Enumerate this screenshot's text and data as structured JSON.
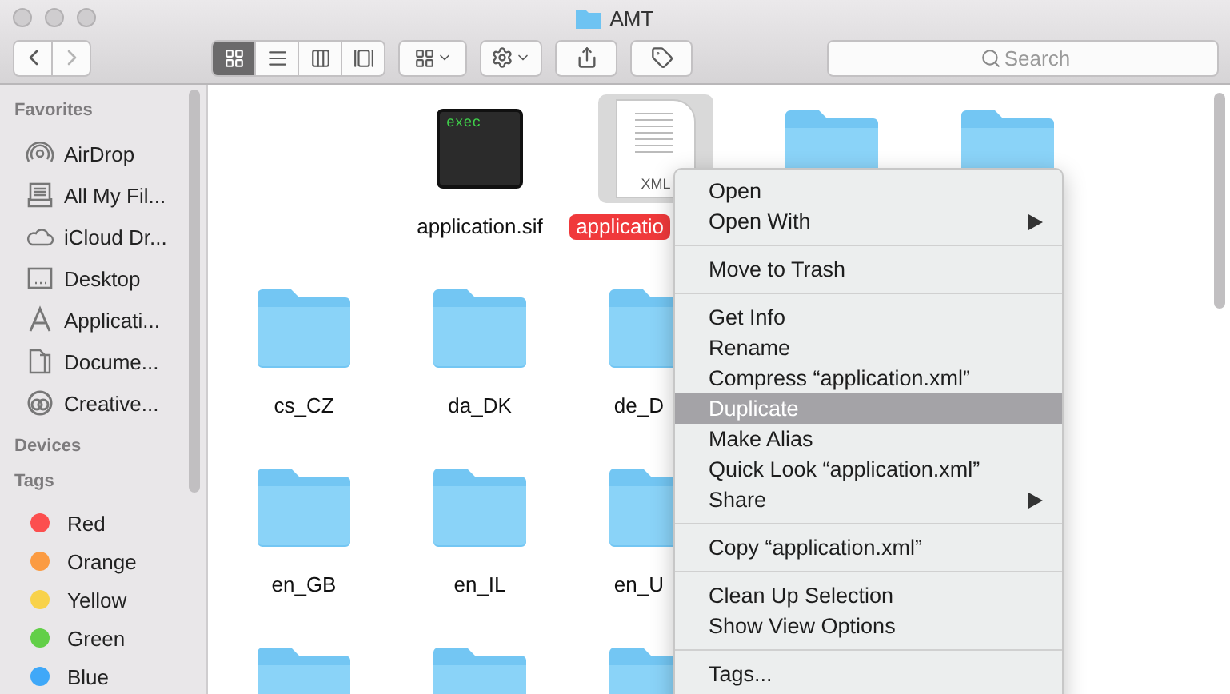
{
  "window": {
    "title": "AMT"
  },
  "toolbar": {
    "view_modes": [
      {
        "selected": true
      },
      {
        "selected": false
      },
      {
        "selected": false
      },
      {
        "selected": false
      }
    ],
    "search": {
      "placeholder": "Search"
    }
  },
  "sidebar": {
    "sections": [
      {
        "heading": "Favorites",
        "items": [
          {
            "label": "AirDrop"
          },
          {
            "label": "All My Fil..."
          },
          {
            "label": "iCloud Dr..."
          },
          {
            "label": "Desktop"
          },
          {
            "label": "Applicati..."
          },
          {
            "label": "Docume..."
          },
          {
            "label": "Creative..."
          }
        ]
      },
      {
        "heading": "Devices"
      },
      {
        "heading": "Tags",
        "items": [
          {
            "label": "Red",
            "color": "#fc4f4f"
          },
          {
            "label": "Orange",
            "color": "#fb9b42"
          },
          {
            "label": "Yellow",
            "color": "#f8d24a"
          },
          {
            "label": "Green",
            "color": "#62cf48"
          },
          {
            "label": "Blue",
            "color": "#3fa8f8"
          }
        ]
      }
    ]
  },
  "files": {
    "rows": [
      [
        {
          "kind": "blank"
        },
        {
          "kind": "exec",
          "badge": "exec",
          "label": "application.sif",
          "selected": false
        },
        {
          "kind": "xml",
          "badge": "XML",
          "label": "applicatio",
          "selected": true
        },
        {
          "kind": "folder",
          "selected": false
        },
        {
          "kind": "folder",
          "selected": false
        }
      ],
      [
        {
          "kind": "folder",
          "label": "cs_CZ",
          "selected": false
        },
        {
          "kind": "folder",
          "label": "da_DK",
          "selected": false
        },
        {
          "kind": "folder",
          "label": "de_D",
          "selected": false
        }
      ],
      [
        {
          "kind": "folder",
          "label": "en_GB",
          "selected": false
        },
        {
          "kind": "folder",
          "label": "en_IL",
          "selected": false
        },
        {
          "kind": "folder",
          "label": "en_U",
          "selected": false
        }
      ],
      [
        {
          "kind": "folder",
          "selected": false
        },
        {
          "kind": "folder",
          "selected": false
        },
        {
          "kind": "folder",
          "selected": false
        }
      ]
    ]
  },
  "context_menu": {
    "groups": [
      [
        {
          "label": "Open",
          "selected": false,
          "submenu": false
        },
        {
          "label": "Open With",
          "selected": false,
          "submenu": true
        }
      ],
      [
        {
          "label": "Move to Trash",
          "selected": false,
          "submenu": false
        }
      ],
      [
        {
          "label": "Get Info",
          "selected": false,
          "submenu": false
        },
        {
          "label": "Rename",
          "selected": false,
          "submenu": false
        },
        {
          "label": "Compress “application.xml”",
          "selected": false,
          "submenu": false
        },
        {
          "label": "Duplicate",
          "selected": true,
          "submenu": false
        },
        {
          "label": "Make Alias",
          "selected": false,
          "submenu": false
        },
        {
          "label": "Quick Look “application.xml”",
          "selected": false,
          "submenu": false
        },
        {
          "label": "Share",
          "selected": false,
          "submenu": true
        }
      ],
      [
        {
          "label": "Copy “application.xml”",
          "selected": false,
          "submenu": false
        }
      ],
      [
        {
          "label": "Clean Up Selection",
          "selected": false,
          "submenu": false
        },
        {
          "label": "Show View Options",
          "selected": false,
          "submenu": false
        }
      ],
      [
        {
          "label": "Tags...",
          "selected": false,
          "submenu": false
        }
      ]
    ]
  }
}
